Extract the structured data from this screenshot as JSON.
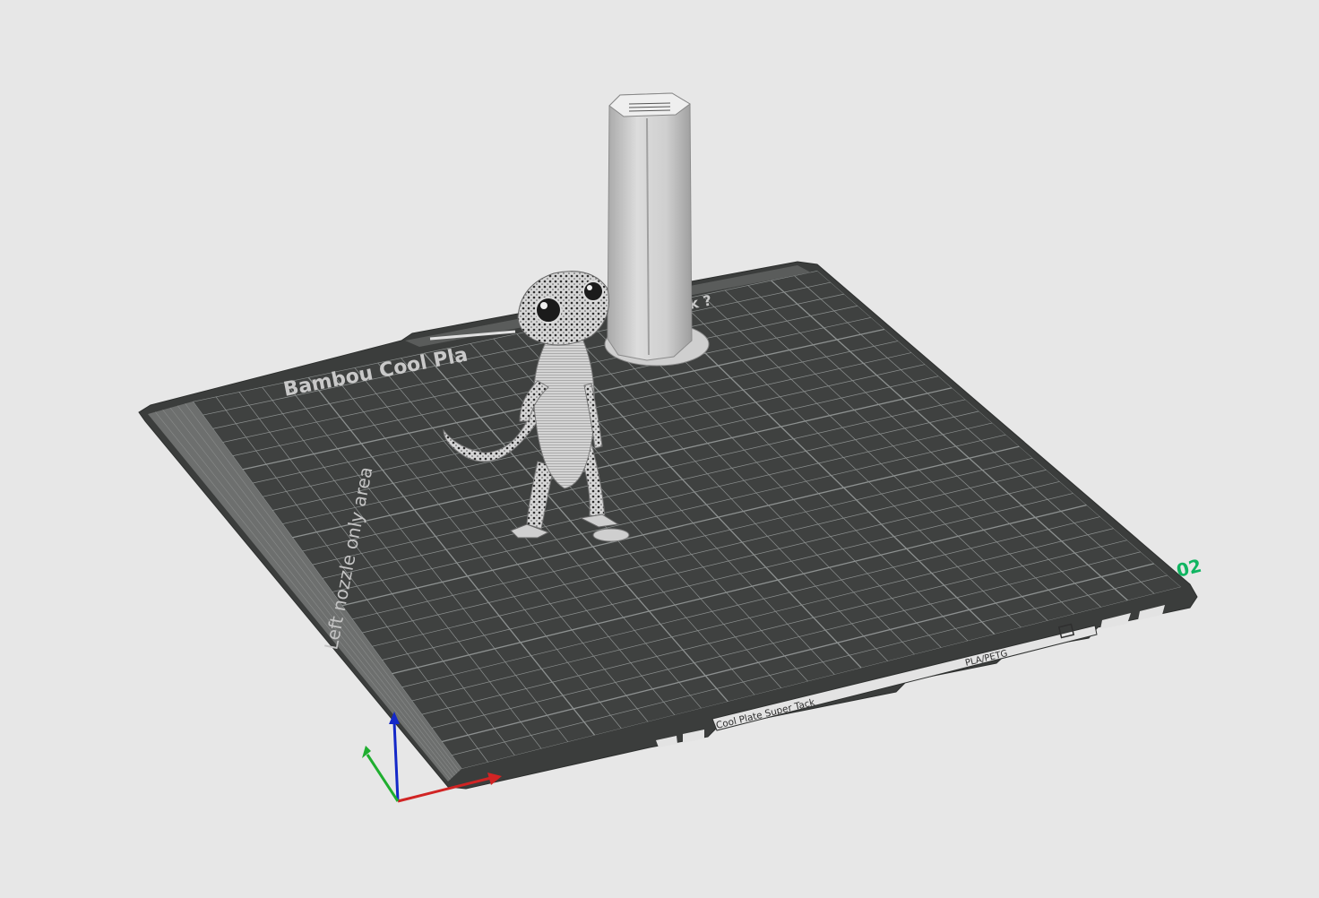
{
  "viewport": {
    "background_color": "#e7e7e7"
  },
  "plate": {
    "number": "02",
    "number_color": "#10b561",
    "surface_color": "#3f4140",
    "grid_color": "#8d9190",
    "exclusion_zone_color": "#6d6f6e",
    "top_label": "Bambou Cool Pla",
    "top_label_tail": "k ?",
    "exclusion_label": "Left nozzle only area",
    "front_plate_name": "Cool Plate Super Tack",
    "material_label": "PLA/PETG"
  },
  "objects": [
    {
      "name": "gecko",
      "color": "#d9d9d9"
    },
    {
      "name": "prime-tower",
      "color": "#d0d0d0"
    }
  ],
  "axes": {
    "x_color": "#d12424",
    "y_color": "#1fae2f",
    "z_color": "#1428c8"
  }
}
